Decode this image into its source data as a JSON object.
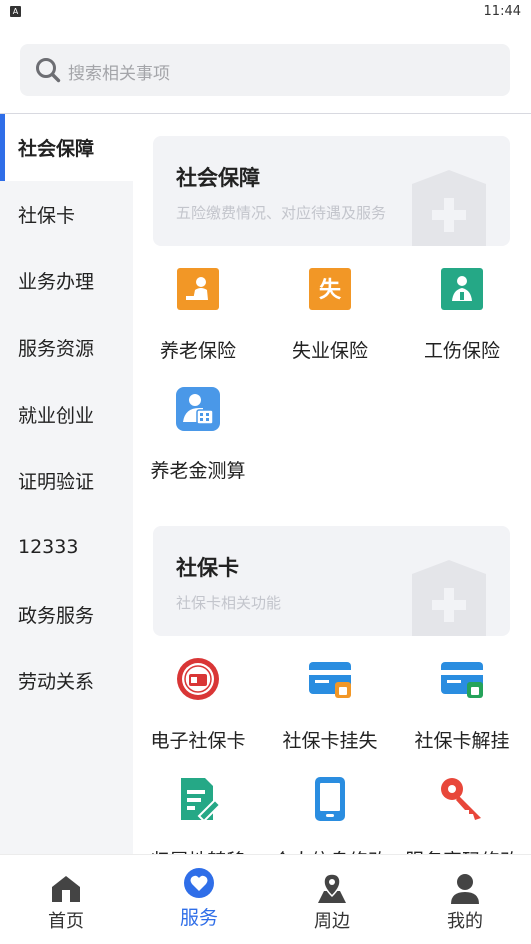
{
  "status_bar": {
    "time": "11:44",
    "notification_glyph": "A"
  },
  "search": {
    "placeholder": "搜索相关事项"
  },
  "sidebar": {
    "items": [
      {
        "label": "社会保障",
        "active": true
      },
      {
        "label": "社保卡"
      },
      {
        "label": "业务办理"
      },
      {
        "label": "服务资源"
      },
      {
        "label": "就业创业"
      },
      {
        "label": "证明验证"
      },
      {
        "label": "12333"
      },
      {
        "label": "政务服务"
      },
      {
        "label": "劳动关系"
      }
    ]
  },
  "sections": [
    {
      "title": "社会保障",
      "subtitle": "五险缴费情况、对应待遇及服务",
      "items": [
        {
          "label": "养老保险",
          "icon": "pension-icon",
          "color": "#f29726"
        },
        {
          "label": "失业保险",
          "icon": "unemployment-icon",
          "color": "#f29726",
          "glyph": "失"
        },
        {
          "label": "工伤保险",
          "icon": "injury-insurance-icon",
          "color": "#25a886"
        },
        {
          "label": "养老金测算",
          "icon": "pension-calculator-icon",
          "color": "#4a98e8"
        }
      ]
    },
    {
      "title": "社保卡",
      "subtitle": "社保卡相关功能",
      "items": [
        {
          "label": "电子社保卡",
          "icon": "e-social-card-icon",
          "color": "#d93636"
        },
        {
          "label": "社保卡挂失",
          "icon": "card-report-loss-icon",
          "color": "#2a8de0"
        },
        {
          "label": "社保卡解挂",
          "icon": "card-unlock-icon",
          "color": "#2a8de0"
        },
        {
          "label": "归属地转移",
          "icon": "transfer-location-icon",
          "color": "#25a886"
        },
        {
          "label": "个人信息修改",
          "icon": "edit-personal-info-icon",
          "color": "#2a8de0"
        },
        {
          "label": "服务密码修改",
          "icon": "change-password-icon",
          "color": "#e8473a"
        }
      ]
    }
  ],
  "tab_bar": {
    "tabs": [
      {
        "label": "首页",
        "icon": "home-icon"
      },
      {
        "label": "服务",
        "icon": "service-heart-icon",
        "active": true
      },
      {
        "label": "周边",
        "icon": "nearby-map-icon"
      },
      {
        "label": "我的",
        "icon": "profile-icon"
      }
    ]
  },
  "colors": {
    "accent": "#2f6ee8",
    "sidebar_bg": "#f4f5f7",
    "banner_bg": "#f2f3f6"
  }
}
